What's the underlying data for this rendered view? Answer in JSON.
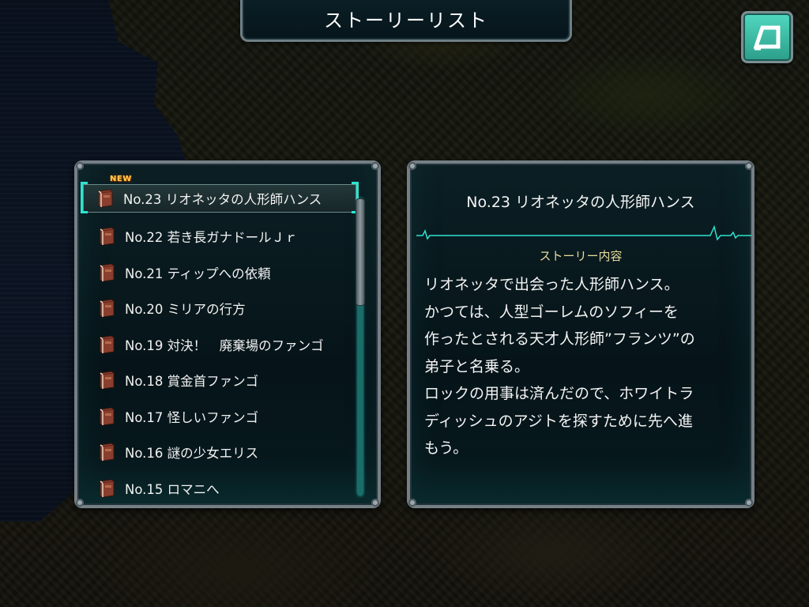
{
  "header": {
    "title": "ストーリーリスト"
  },
  "back_button": {
    "icon": "back-arrow-icon",
    "color": "#3fc9b2"
  },
  "story_list": {
    "new_badge": "NEW",
    "selected_index": 0,
    "items": [
      {
        "label": "No.23 リオネッタの人形師ハンス",
        "is_new": true
      },
      {
        "label": "No.22 若き長ガナドールＪｒ"
      },
      {
        "label": "No.21 ティップへの依頼"
      },
      {
        "label": "No.20 ミリアの行方"
      },
      {
        "label": "No.19 対決！　廃棄場のファンゴ"
      },
      {
        "label": "No.18 賞金首ファンゴ"
      },
      {
        "label": "No.17 怪しいファンゴ"
      },
      {
        "label": "No.16 謎の少女エリス"
      },
      {
        "label": "No.15 ロマニへ"
      }
    ],
    "item_icon": "book-icon",
    "scroll_fraction": 0
  },
  "detail": {
    "title": "No.23 リオネッタの人形師ハンス",
    "section_label": "ストーリー内容",
    "body": "リオネッタで出会った人形師ハンス。\nかつては、人型ゴーレムのソフィーを\n作ったとされる天才人形師”フランツ”の\n弟子と名乗る。\nロックの用事は済んだので、ホワイトラ\nディッシュのアジトを探すために先へ進\nもう。"
  },
  "colors": {
    "accent": "#2de3d0",
    "panel_bg": "#071a1e",
    "label_gold": "#e8dc9c",
    "new_badge": "#ffd04a"
  }
}
